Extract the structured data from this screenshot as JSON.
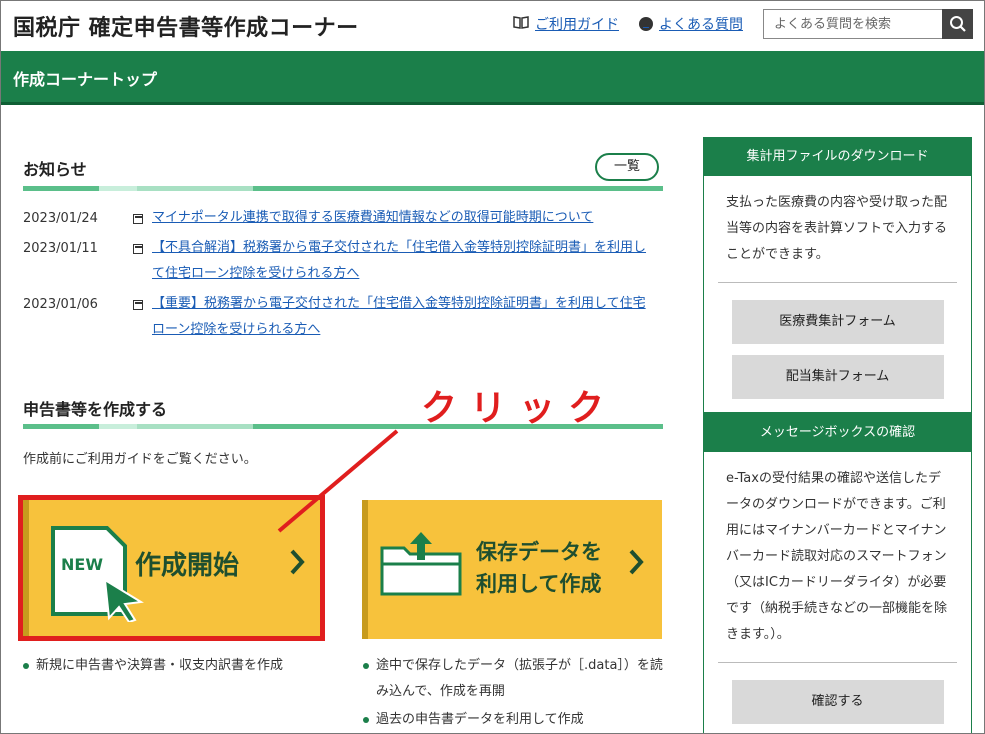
{
  "header": {
    "site_title": "国税庁 確定申告書等作成コーナー",
    "guide_link": "ご利用ガイド",
    "faq_link": "よくある質問",
    "search_placeholder": "よくある質問を検索"
  },
  "greenbar": {
    "label": "作成コーナートップ"
  },
  "news": {
    "title": "お知らせ",
    "list_button": "一覧",
    "items": [
      {
        "date": "2023/01/24",
        "text": "マイナポータル連携で取得する医療費通知情報などの取得可能時期について"
      },
      {
        "date": "2023/01/11",
        "text": "【不具合解消】税務署から電子交付された「住宅借入金等特別控除証明書」を利用して住宅ローン控除を受けられる方へ"
      },
      {
        "date": "2023/01/06",
        "text": "【重要】税務署から電子交付された「住宅借入金等特別控除証明書」を利用して住宅ローン控除を受けられる方へ"
      }
    ]
  },
  "create": {
    "title": "申告書等を作成する",
    "note": "作成前にご利用ガイドをご覧ください。",
    "start_label": "作成開始",
    "new_badge": "NEW",
    "saved_label_1": "保存データを",
    "saved_label_2": "利用して作成",
    "start_bullets": [
      "新規に申告書や決算書・収支内訳書を作成"
    ],
    "saved_bullets": [
      "途中で保存したデータ（拡張子が［.data］）を読み込んで、作成を再開",
      "過去の申告書データを利用して作成"
    ]
  },
  "annotation": {
    "click_text": "クリック",
    "color": "#e01e1e"
  },
  "side": {
    "download": {
      "title": "集計用ファイルのダウンロード",
      "text": "支払った医療費の内容や受け取った配当等の内容を表計算ソフトで入力することができます。",
      "buttons": [
        "医療費集計フォーム",
        "配当集計フォーム"
      ]
    },
    "messagebox": {
      "title": "メッセージボックスの確認",
      "text": "e-Taxの受付結果の確認や送信したデータのダウンロードができます。ご利用にはマイナンバーカードとマイナンバーカード読取対応のスマートフォン（又はICカードリーダライタ）が必要です（納税手続きなどの一部機能を除きます。）。",
      "button": "確認する"
    }
  },
  "colors": {
    "brand_green": "#1b7f4a",
    "card_yellow": "#f7c23c",
    "link_blue": "#1a5cb5"
  }
}
